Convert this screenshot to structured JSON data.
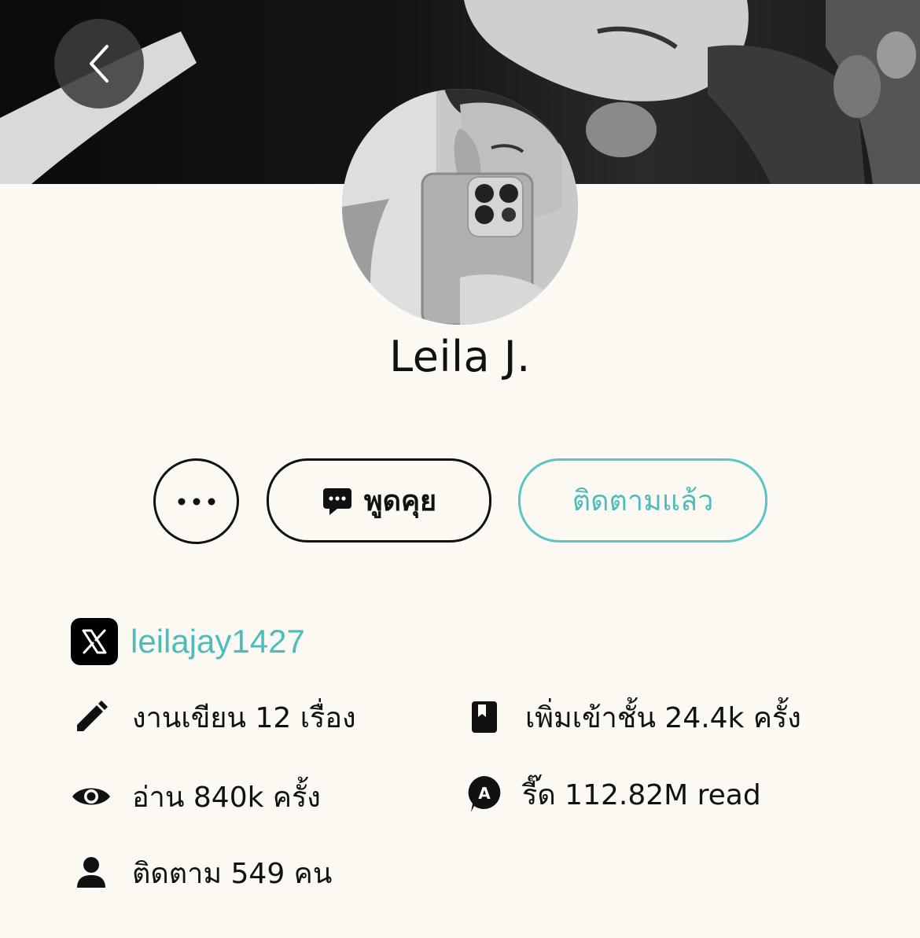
{
  "header": {
    "back_icon": "chevron-left-icon"
  },
  "profile": {
    "name": "Leila J."
  },
  "actions": {
    "more_icon": "ellipsis-icon",
    "chat_icon": "chat-bubble-icon",
    "chat_label": "พูดคุย",
    "follow_label": "ติดตามแล้ว"
  },
  "social": {
    "platform_icon": "x-logo-icon",
    "handle": "leilajay1427"
  },
  "stats": {
    "works": {
      "icon": "pencil-icon",
      "text": "งานเขียน 12 เรื่อง"
    },
    "library": {
      "icon": "book-bookmark-icon",
      "text": "เพิ่มเข้าชั้น 24.4k ครั้ง"
    },
    "reads": {
      "icon": "eye-icon",
      "text": "อ่าน 840k ครั้ง"
    },
    "reed": {
      "icon": "coin-badge-icon",
      "text": "รี๊ด 112.82M read"
    },
    "followers": {
      "icon": "person-icon",
      "text": "ติดตาม 549 คน"
    }
  },
  "colors": {
    "background": "#fcf9f3",
    "accent": "#4fbcbc",
    "text": "#111111"
  }
}
